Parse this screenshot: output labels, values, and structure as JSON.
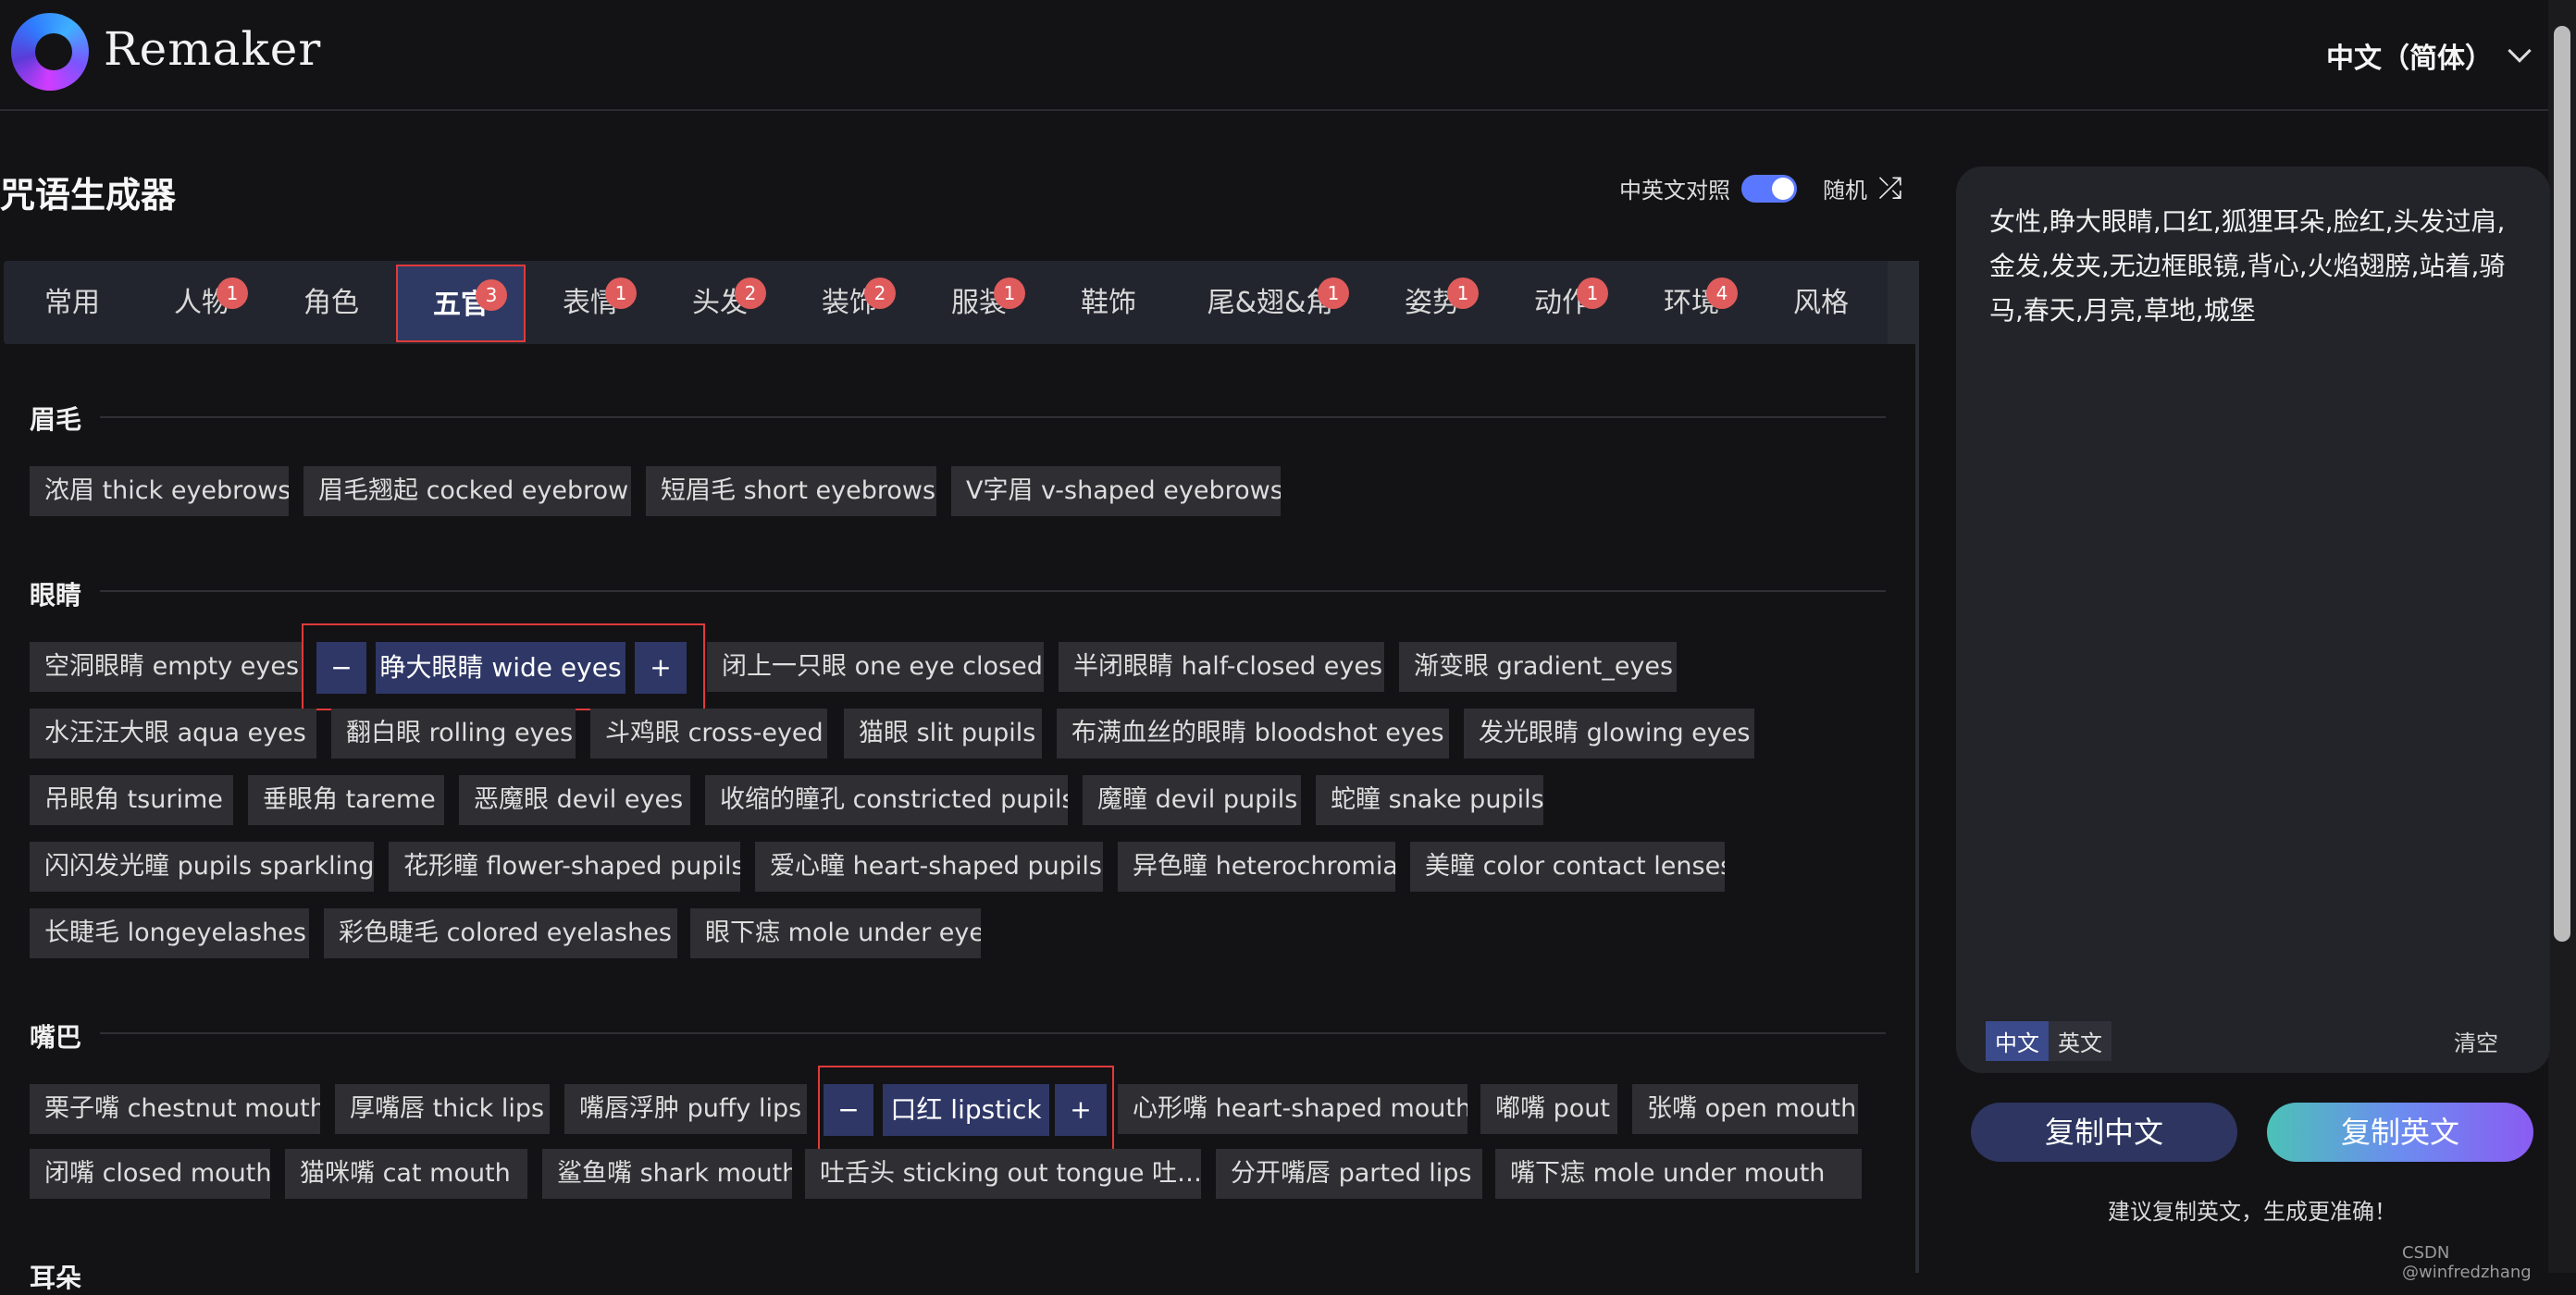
{
  "header": {
    "brand": "Remaker",
    "language": "中文（简体）"
  },
  "page": {
    "title": "咒语生成器",
    "bilingual_label": "中英文对照",
    "bilingual_on": true,
    "random_label": "随机",
    "shuffle_icon": "⤮"
  },
  "tabs": [
    {
      "label": "常用",
      "badge": ""
    },
    {
      "label": "人物",
      "badge": "1"
    },
    {
      "label": "角色",
      "badge": ""
    },
    {
      "label": "五官",
      "badge": "3",
      "active": true
    },
    {
      "label": "表情",
      "badge": "1"
    },
    {
      "label": "头发",
      "badge": "2"
    },
    {
      "label": "装饰",
      "badge": "2"
    },
    {
      "label": "服装",
      "badge": "1"
    },
    {
      "label": "鞋饰",
      "badge": ""
    },
    {
      "label": "尾&翅&角",
      "badge": "1"
    },
    {
      "label": "姿势",
      "badge": "1"
    },
    {
      "label": "动作",
      "badge": "1"
    },
    {
      "label": "环境",
      "badge": "4"
    },
    {
      "label": "风格",
      "badge": ""
    }
  ],
  "sections": {
    "eyebrows": {
      "title": "眉毛",
      "chips": [
        "浓眉 thick eyebrows",
        "眉毛翘起 cocked eyebrow",
        "短眉毛 short eyebrows",
        "V字眉 v-shaped eyebrows"
      ]
    },
    "eyes": {
      "title": "眼睛",
      "chips": [
        "空洞眼睛 empty eyes",
        "闭上一只眼 one eye closed",
        "半闭眼睛 half-closed eyes",
        "渐变眼 gradient_eyes",
        "水汪汪大眼 aqua eyes",
        "翻白眼 rolling eyes",
        "斗鸡眼 cross-eyed",
        "猫眼 slit pupils",
        "布满血丝的眼睛 bloodshot eyes",
        "发光眼睛 glowing eyes",
        "吊眼角 tsurime",
        "垂眼角 tareme",
        "恶魔眼 devil eyes",
        "收缩的瞳孔 constricted pupils",
        "魔瞳 devil pupils",
        "蛇瞳 snake pupils",
        "闪闪发光瞳 pupils sparkling",
        "花形瞳 flower-shaped pupils",
        "爱心瞳 heart-shaped pupils",
        "异色瞳 heterochromia",
        "美瞳 color contact lenses",
        "长睫毛 longeyelashes",
        "彩色睫毛 colored eyelashes",
        "眼下痣 mole under eye"
      ],
      "selected": "睁大眼睛 wide eyes"
    },
    "mouth": {
      "title": "嘴巴",
      "chips": [
        "栗子嘴 chestnut mouth",
        "厚嘴唇 thick lips",
        "嘴唇浮肿 puffy lips",
        "心形嘴 heart-shaped mouth",
        "嘟嘴 pout",
        "张嘴 open mouth",
        "闭嘴 closed mouth",
        "猫咪嘴 cat mouth",
        "鲨鱼嘴 shark mouth",
        "吐舌头 sticking out tongue  吐…",
        "分开嘴唇 parted lips",
        "嘴下痣 mole under mouth"
      ],
      "selected": "口红 lipstick"
    },
    "ears": {
      "title": "耳朵"
    }
  },
  "stepper": {
    "minus": "−",
    "plus": "+"
  },
  "output": {
    "text": "女性,睁大眼睛,口红,狐狸耳朵,脸红,头发过肩,金发,发夹,无边框眼镜,背心,火焰翅膀,站着,骑马,春天,月亮,草地,城堡",
    "seg_cn": "中文",
    "seg_en": "英文",
    "clear": "清空",
    "copy_cn": "复制中文",
    "copy_en": "复制英文",
    "hint": "建议复制英文，生成更准确！"
  },
  "watermark": "CSDN @winfredzhang",
  "colors": {
    "accent": "#5a78ff",
    "badge": "#e05b5b",
    "selected_bg": "#2e3766",
    "highlight_border": "#e03a3a"
  }
}
